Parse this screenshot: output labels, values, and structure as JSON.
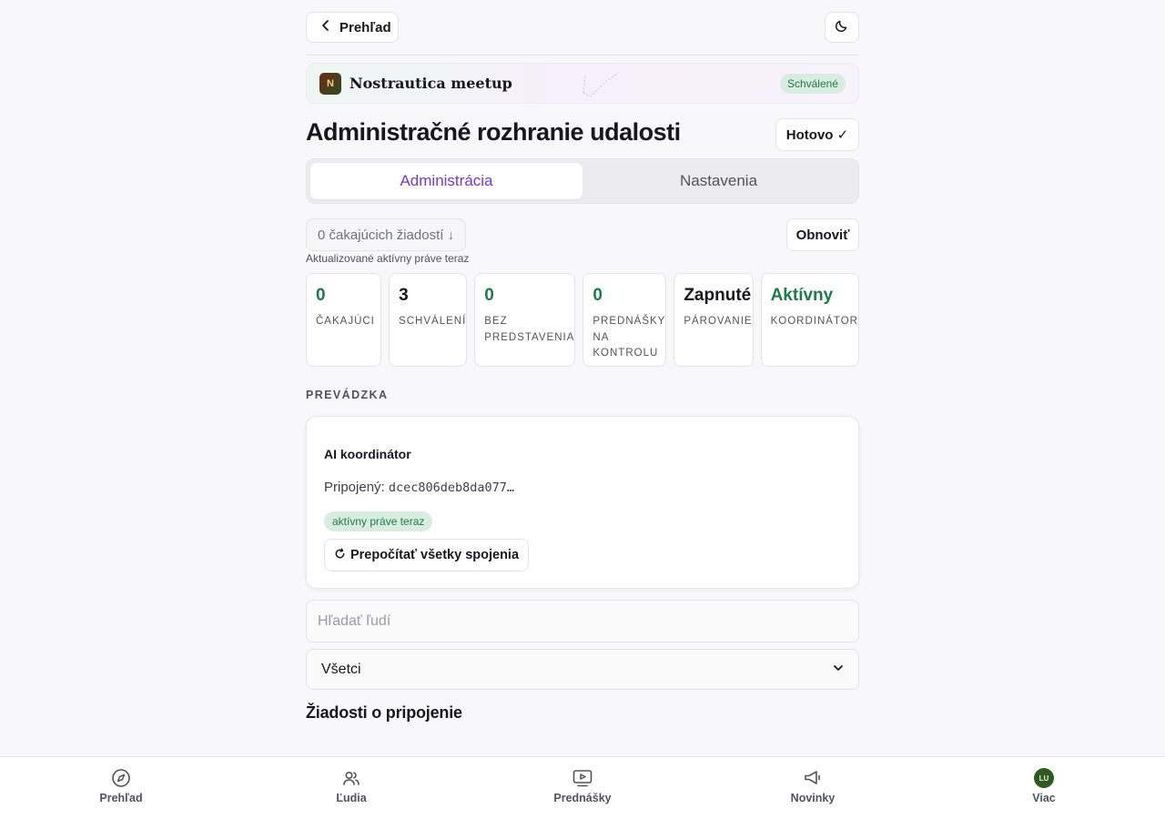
{
  "topbar": {
    "back_label": "Prehľad",
    "theme_icon": "moon-icon"
  },
  "event": {
    "logo_letter": "N",
    "name": "Nostrautica meetup",
    "status": "Schválené"
  },
  "header": {
    "title": "Administračné rozhranie udalosti",
    "done_label": "Hotovo ✓"
  },
  "tabs": [
    {
      "label": "Administrácia",
      "active": true
    },
    {
      "label": "Nastavenia",
      "active": false
    }
  ],
  "requests_bar": {
    "pending_label": "0 čakajúcich žiadostí ↓",
    "refresh_label": "Obnoviť",
    "updated_text": "Aktualizované aktívny práve teraz"
  },
  "stats": [
    {
      "value": "0",
      "label": "Čakajúci",
      "color": "#1f7a4a"
    },
    {
      "value": "3",
      "label": "Schválení",
      "color": "#18181b"
    },
    {
      "value": "0",
      "label": "Bez\npredstavenia",
      "color": "#1f7a4a"
    },
    {
      "value": "0",
      "label": "Prednášky\nna\nkontrolu",
      "color": "#1f7a4a"
    },
    {
      "value": "Zapnuté",
      "label": "Párovanie",
      "color": "#18181b"
    },
    {
      "value": "Aktívny",
      "label": "Koordinátor",
      "color": "#1f7a4a"
    }
  ],
  "operations": {
    "section_label": "PREVÁDZKA",
    "card_title": "AI koordinátor",
    "connected_label": "Pripojený:",
    "connected_id": "dcec806deb8da077…",
    "active_badge": "aktívny práve teraz",
    "recalc_label": "Prepočítať všetky spojenia"
  },
  "search": {
    "placeholder": "Hľadať ľudí"
  },
  "filter": {
    "selected": "Všetci"
  },
  "requests": {
    "heading": "Žiadosti o pripojenie"
  },
  "bottom_nav": [
    {
      "label": "Prehľad",
      "icon": "compass-icon"
    },
    {
      "label": "Ľudia",
      "icon": "people-icon"
    },
    {
      "label": "Prednášky",
      "icon": "video-icon"
    },
    {
      "label": "Novinky",
      "icon": "megaphone-icon"
    },
    {
      "label": "Viac",
      "icon": "avatar-icon",
      "avatar_initials": "LU"
    }
  ],
  "colors": {
    "accent": "#6d3ad8",
    "success": "#1f7a4a",
    "success_bg": "#d8ece0"
  }
}
